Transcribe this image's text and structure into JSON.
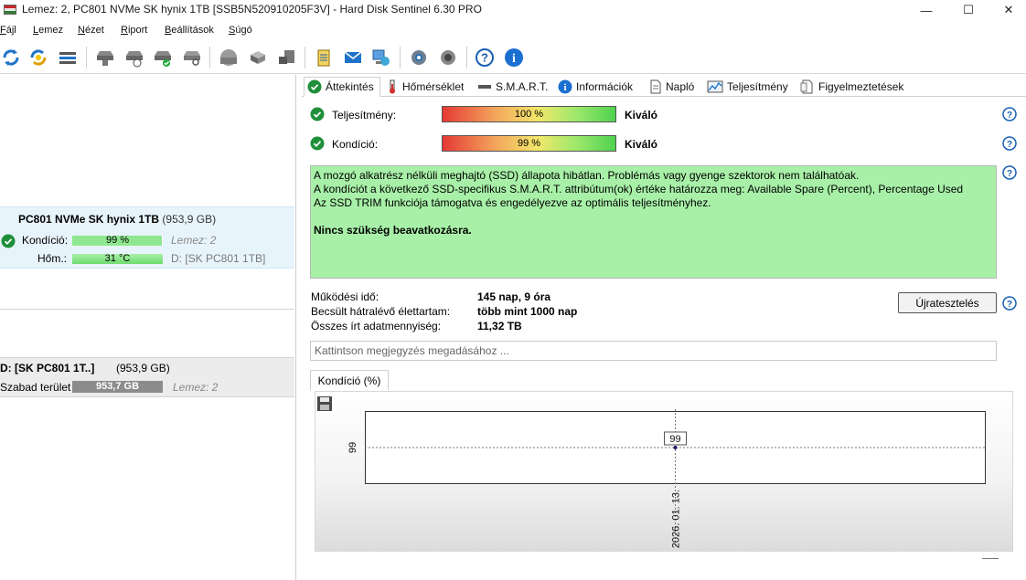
{
  "window": {
    "title": "Lemez: 2, PC801 NVMe SK hynix 1TB [SSB5N520910205F3V]  -  Hard Disk Sentinel 6.30 PRO",
    "minimize_glyph": "—",
    "maximize_glyph": "☐",
    "close_glyph": "✕"
  },
  "menu": {
    "items": [
      {
        "label": "Fájl",
        "accel": "F"
      },
      {
        "label": "Lemez",
        "accel": "L"
      },
      {
        "label": "Nézet",
        "accel": "N"
      },
      {
        "label": "Riport",
        "accel": "R"
      },
      {
        "label": "Beállítások",
        "accel": "B"
      },
      {
        "label": "Súgó",
        "accel": "S"
      }
    ]
  },
  "toolbar": {
    "icons": [
      "refresh-icon",
      "refresh-all-icon",
      "disk-list-icon",
      "disk-icon",
      "disk-clock-icon",
      "disk-check-icon",
      "disk-search-icon",
      "hdd-icon",
      "drive-copy-icon",
      "drive-eject-icon",
      "notepad-icon",
      "mail-icon",
      "network-icon",
      "gear-icon",
      "sound-icon",
      "help-icon",
      "info-icon"
    ]
  },
  "left": {
    "disk": {
      "name": "PC801 NVMe SK hynix 1TB",
      "size": "(953,9 GB)",
      "health_label": "Kondíció:",
      "health_value": "99 %",
      "health_fraction": 0.99,
      "disk_ref": "Lemez: 2",
      "temp_label": "Hőm.:",
      "temp_value": "31 °C",
      "partition_ref": "D: [SK PC801 1TB]"
    },
    "partition": {
      "name": "D: [SK PC801 1T..]",
      "size": "(953,9 GB)",
      "free_label": "Szabad terület",
      "free_value": "953,7 GB",
      "disk_ref": "Lemez: 2"
    }
  },
  "tabs": [
    {
      "label": "Áttekintés",
      "icon": "check-icon",
      "active": true
    },
    {
      "label": "Hőmérséklet",
      "icon": "thermometer-icon",
      "active": false
    },
    {
      "label": "S.M.A.R.T.",
      "icon": "smart-icon",
      "active": false
    },
    {
      "label": "Információk",
      "icon": "info-icon",
      "active": false
    },
    {
      "label": "Napló",
      "icon": "log-icon",
      "active": false
    },
    {
      "label": "Teljesítmény",
      "icon": "chart-icon",
      "active": false
    },
    {
      "label": "Figyelmeztetések",
      "icon": "alert-icon",
      "active": false
    }
  ],
  "overview": {
    "performance_label": "Teljesítmény:",
    "performance_value": "100 %",
    "performance_rating": "Kiváló",
    "health_label": "Kondíció:",
    "health_value": "99 %",
    "health_rating": "Kiváló",
    "description": [
      "A mozgó alkatrész nélküli meghajtó (SSD) állapota hibátlan. Problémás vagy gyenge szektorok nem találhatóak.",
      "A kondíciót a következő SSD-specifikus S.M.A.R.T. attribútum(ok) értéke határozza meg:  Available Spare (Percent), Percentage Used",
      "Az SSD TRIM funkciója támogatva és engedélyezve az optimális teljesítményhez."
    ],
    "recommendation": "Nincs szükség beavatkozásra.",
    "uptime_label": "Működési idő:",
    "uptime_value": "145 nap, 9 óra",
    "lifetime_label": "Becsült hátralévő élettartam:",
    "lifetime_value": "több mint 1000 nap",
    "written_label": "Összes írt adatmennyiség:",
    "written_value": "11,32 TB",
    "retest_button": "Újratesztelés",
    "note_placeholder": "Kattintson megjegyzés megadásához ..."
  },
  "chart_tab_label": "Kondíció  (%)",
  "chart_data": {
    "type": "line",
    "x": [
      "2026. 01. 13."
    ],
    "series": [
      {
        "values": [
          99
        ]
      }
    ],
    "y_tick_labels": [
      "99"
    ],
    "data_labels": [
      "99"
    ],
    "grid": true
  },
  "colors": {
    "accent_green": "#a8f0a8",
    "selected_row": "#e8f4fb",
    "help_blue": "#1a5fb4"
  }
}
